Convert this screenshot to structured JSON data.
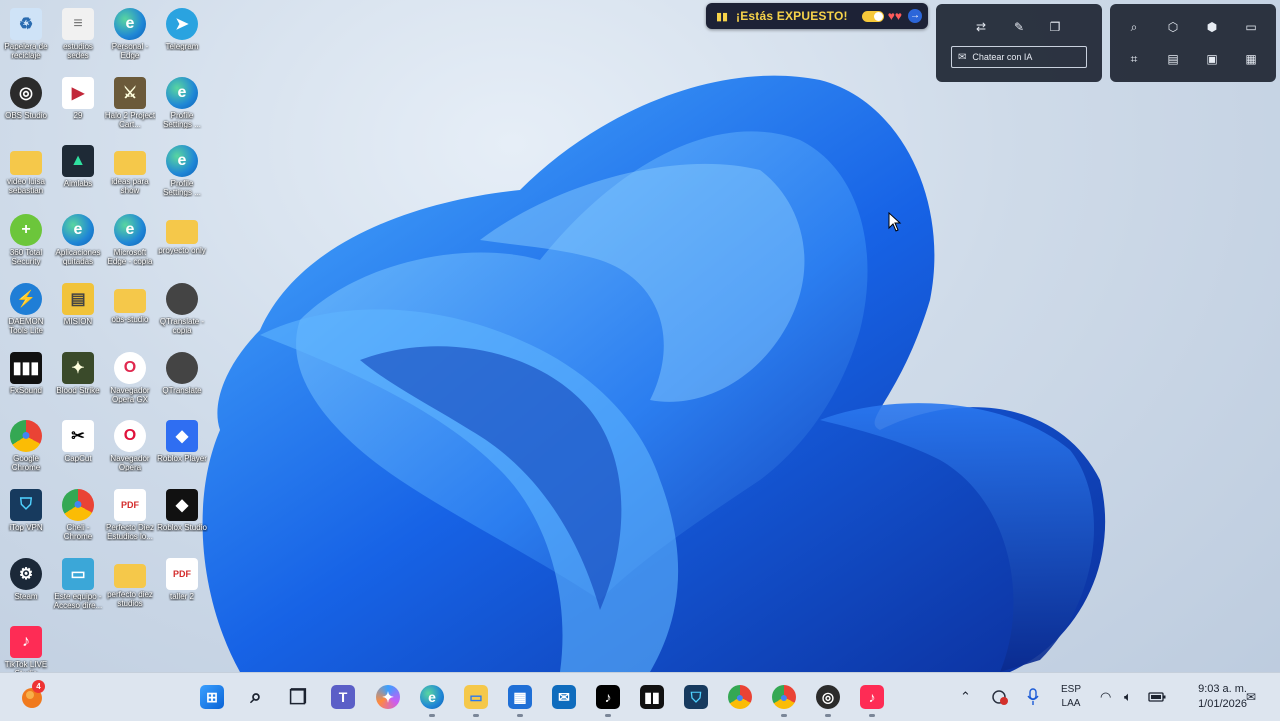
{
  "desktop_icons": [
    {
      "label": "Papelera de reciclaje",
      "icon": "recycle-bin-icon"
    },
    {
      "label": "estudios sedes",
      "icon": "document-icon"
    },
    {
      "label": "Personal - Edge",
      "icon": "edge-icon"
    },
    {
      "label": "Telegram",
      "icon": "telegram-icon"
    },
    {
      "label": "OBS Studio",
      "icon": "obs-icon"
    },
    {
      "label": "29",
      "icon": "video-file-icon"
    },
    {
      "label": "Halo 2 Project Cart...",
      "icon": "halo-icon"
    },
    {
      "label": "Profile Settings ...",
      "icon": "edge-icon"
    },
    {
      "label": "video luisa sebastian",
      "icon": "folder-icon"
    },
    {
      "label": "Aimlabs",
      "icon": "aimlabs-icon"
    },
    {
      "label": "ideas para show",
      "icon": "folder-icon"
    },
    {
      "label": "Profile Settings ...",
      "icon": "edge-icon"
    },
    {
      "label": "360 Total Security",
      "icon": "360-security-icon"
    },
    {
      "label": "Aplicaciones quitadas",
      "icon": "edge-icon"
    },
    {
      "label": "Microsoft Edge - copia",
      "icon": "edge-icon"
    },
    {
      "label": "proyecto only",
      "icon": "folder-icon"
    },
    {
      "label": "DAEMON Tools Lite",
      "icon": "daemon-tools-icon"
    },
    {
      "label": "MISION",
      "icon": "zip-folder-icon"
    },
    {
      "label": "obs-studio",
      "icon": "folder-icon"
    },
    {
      "label": "QTranslate - copia",
      "icon": "qtranslate-icon"
    },
    {
      "label": "FxSound",
      "icon": "fxsound-icon"
    },
    {
      "label": "Blood Strike",
      "icon": "blood-strike-icon"
    },
    {
      "label": "Navegador Opera GX",
      "icon": "opera-gx-icon"
    },
    {
      "label": "QTranslate",
      "icon": "qtranslate-icon"
    },
    {
      "label": "Google Chrome",
      "icon": "chrome-icon"
    },
    {
      "label": "CapCut",
      "icon": "capcut-icon"
    },
    {
      "label": "Navegador Opera",
      "icon": "opera-icon"
    },
    {
      "label": "Roblox Player",
      "icon": "roblox-player-icon"
    },
    {
      "label": "iTop VPN",
      "icon": "itop-vpn-icon"
    },
    {
      "label": "Cheli - Chrome",
      "icon": "chrome-profile-icon"
    },
    {
      "label": "Perfecto Diez Estudios lo...",
      "icon": "pdf-icon"
    },
    {
      "label": "Roblox Studio",
      "icon": "roblox-studio-icon"
    },
    {
      "label": "Steam",
      "icon": "steam-icon"
    },
    {
      "label": "Este equipo - Acceso dire...",
      "icon": "this-pc-icon"
    },
    {
      "label": "perfecto diez studios",
      "icon": "folder-icon"
    },
    {
      "label": "taller 2",
      "icon": "pdf-icon"
    },
    {
      "label": "TikTok LIVE Studio",
      "icon": "tiktok-live-icon"
    }
  ],
  "exposed_banner": {
    "text": "¡Estás EXPUESTO!",
    "icon": "signal-icon"
  },
  "overlay_left": {
    "chat_label": "Chatear con IA",
    "buttons": [
      "translate-icon",
      "pen-icon",
      "copy-icon"
    ]
  },
  "overlay_right": {
    "buttons": [
      "search-icon",
      "cube-icon",
      "cube-add-icon",
      "folder-icon",
      "crop-icon",
      "document-icon",
      "image-icon",
      "grid-icon"
    ]
  },
  "taskbar": {
    "start_badge": "4",
    "apps": [
      "start-icon",
      "search-icon",
      "task-view-icon",
      "teams-icon",
      "copilot-icon",
      "edge-icon",
      "file-explorer-icon",
      "store-icon",
      "outlook-icon",
      "tiktok-icon",
      "fxsound-icon",
      "itop-vpn-icon",
      "chrome-icon",
      "chrome-profile-icon",
      "obs-icon",
      "tiktok-live-icon"
    ],
    "lang_line1": "ESP",
    "lang_line2": "LAA",
    "time": "9:03 a. m.",
    "date": "1/01/2026"
  },
  "colors": {
    "accent": "#1a5ad6",
    "taskbar": "#dde5ef",
    "banner_bg": "#1d2236",
    "banner_text": "#f6d34a"
  }
}
